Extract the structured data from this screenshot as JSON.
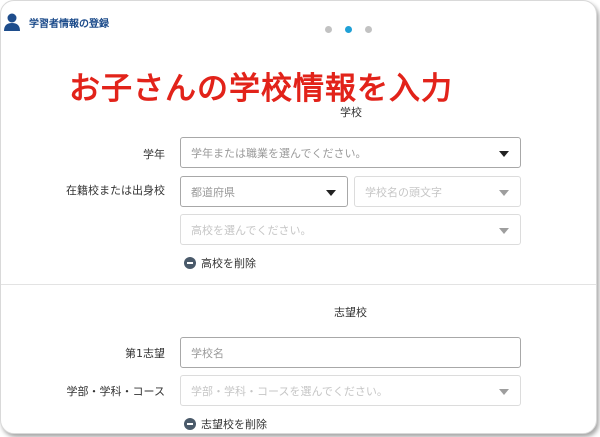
{
  "header": {
    "title": "学習者情報の登録",
    "icon": "user-icon"
  },
  "steps": {
    "total": 3,
    "active_index": 2
  },
  "banner": {
    "text": "お子さんの学校情報を入力",
    "color": "#e2231a"
  },
  "school_section": {
    "title": "学校",
    "grade": {
      "label": "学年",
      "placeholder": "学年または職業を選んでください。"
    },
    "enrolled": {
      "label": "在籍校または出身校",
      "prefecture_placeholder": "都道府県",
      "initial_placeholder": "学校名の頭文字",
      "school_placeholder": "高校を選んでください。"
    },
    "remove_label": "高校を削除"
  },
  "aspiration_section": {
    "title": "志望校",
    "first_choice": {
      "label": "第1志望",
      "placeholder": "学校名"
    },
    "faculty": {
      "label": "学部・学科・コース",
      "placeholder": "学部・学科・コースを選んでください。"
    },
    "remove_label": "志望校を削除"
  },
  "colors": {
    "accent": "#1fa0d6",
    "title_blue": "#1e4d8c"
  }
}
